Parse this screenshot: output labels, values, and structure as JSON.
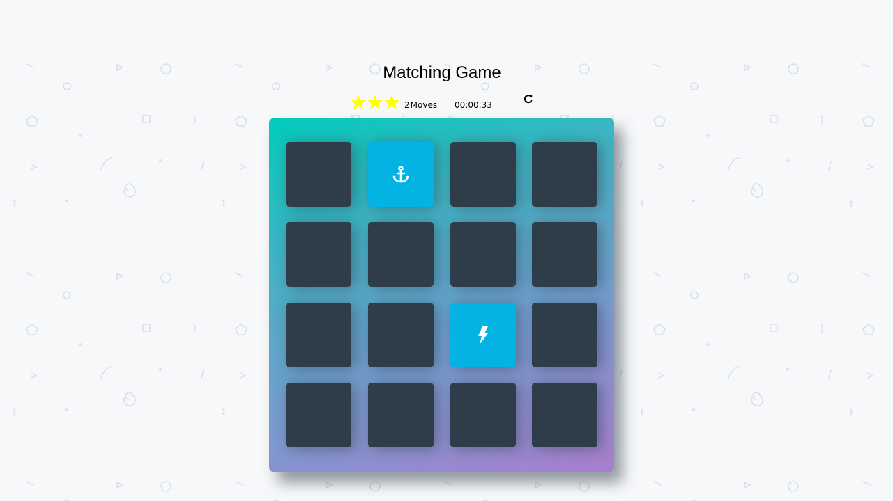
{
  "title": "Matching Game",
  "score_panel": {
    "stars": 3,
    "moves_count": "2",
    "moves_label": "Moves",
    "timer": "00:00:33",
    "restart_icon": "repeat-icon"
  },
  "colors": {
    "card_closed": "#2e3d49",
    "card_open": "#02b3e4",
    "star": "#ffff00",
    "deck_gradient_start": "#02ccba",
    "deck_gradient_end": "#aa7ecd"
  },
  "deck": {
    "rows": 4,
    "cols": 4,
    "cards": [
      {
        "state": "closed",
        "icon": ""
      },
      {
        "state": "open",
        "icon": "anchor-icon"
      },
      {
        "state": "closed",
        "icon": ""
      },
      {
        "state": "closed",
        "icon": ""
      },
      {
        "state": "closed",
        "icon": ""
      },
      {
        "state": "closed",
        "icon": ""
      },
      {
        "state": "closed",
        "icon": ""
      },
      {
        "state": "closed",
        "icon": ""
      },
      {
        "state": "closed",
        "icon": ""
      },
      {
        "state": "closed",
        "icon": ""
      },
      {
        "state": "open",
        "icon": "bolt-icon"
      },
      {
        "state": "closed",
        "icon": ""
      },
      {
        "state": "closed",
        "icon": ""
      },
      {
        "state": "closed",
        "icon": ""
      },
      {
        "state": "closed",
        "icon": ""
      },
      {
        "state": "closed",
        "icon": ""
      }
    ]
  }
}
